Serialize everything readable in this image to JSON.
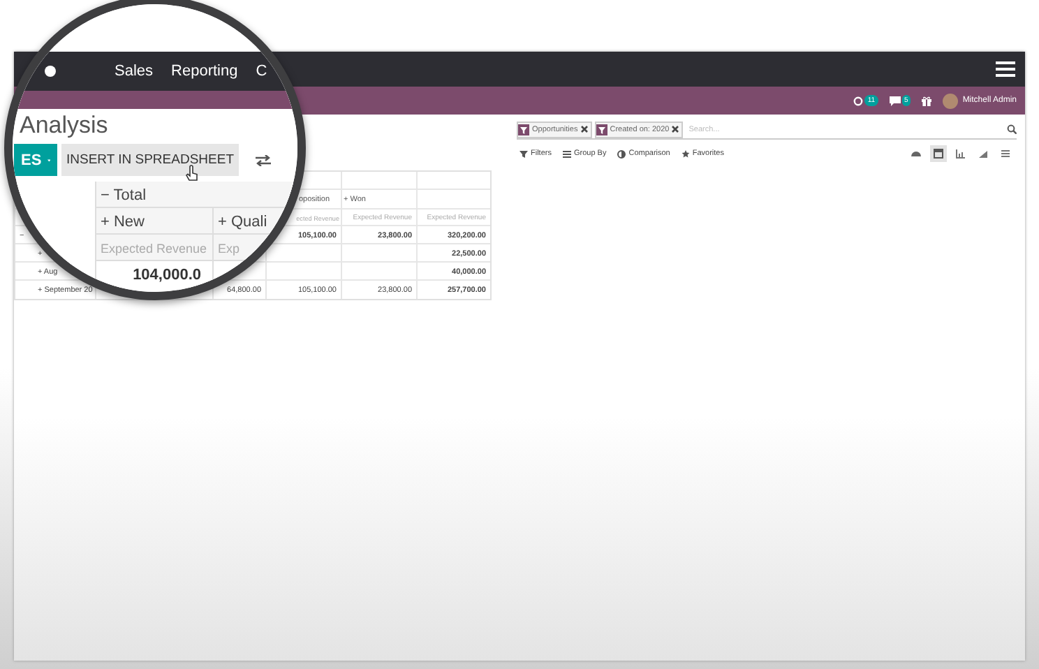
{
  "top_bar": {
    "menu": [
      {
        "label": "Sales"
      },
      {
        "label": "Reporting"
      },
      {
        "label": "C"
      }
    ]
  },
  "systray": {
    "activity_count": "11",
    "message_count": "5",
    "user": "Mitchell Admin"
  },
  "page_title": "Analysis",
  "buttons": {
    "dropdown": "ES",
    "insert": "INSERT IN SPREADSHEET"
  },
  "search": {
    "facets": [
      {
        "label": "Opportunities"
      },
      {
        "label": "Created on: 2020"
      }
    ],
    "placeholder": "Search..."
  },
  "filter_bar": [
    {
      "kind": "filters",
      "label": "Filters"
    },
    {
      "kind": "group",
      "label": "Group By"
    },
    {
      "kind": "comparison",
      "label": "Comparison"
    },
    {
      "kind": "favorites",
      "label": "Favorites"
    }
  ],
  "views": [
    {
      "kind": "dashboard",
      "selected": false
    },
    {
      "kind": "pivot",
      "selected": true
    },
    {
      "kind": "graph",
      "selected": false
    },
    {
      "kind": "line",
      "selected": false
    },
    {
      "kind": "list",
      "selected": false
    }
  ],
  "magnified_pivot": {
    "header": "− Total",
    "columns": [
      "+ New",
      "+ Quali"
    ],
    "measures": [
      "Expected Revenue",
      "Exp"
    ],
    "value": "104,000.0"
  },
  "pivot": {
    "headers": [
      "oposition",
      "+ Won"
    ],
    "measures": [
      "ected Revenue",
      "Expected Revenue",
      "Expected Revenue"
    ],
    "rows": [
      {
        "kind": "total",
        "label": "−",
        "cells": [
          null,
          "105,100.00",
          "23,800.00",
          "320,200.00"
        ]
      },
      {
        "kind": "group",
        "label": "+",
        "cells": [
          null,
          null,
          null,
          "22,500.00"
        ]
      },
      {
        "kind": "group",
        "label": "+ Aug",
        "cells": [
          null,
          null,
          null,
          "40,000.00"
        ]
      },
      {
        "kind": "group",
        "label": "+ September 20",
        "cells": [
          "64,800.00",
          "105,100.00",
          "23,800.00",
          "257,700.00"
        ]
      }
    ]
  }
}
